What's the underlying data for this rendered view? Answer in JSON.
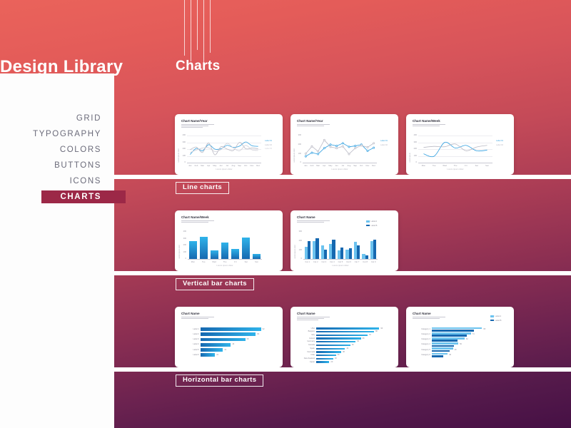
{
  "page": {
    "title": "Design Library",
    "section_heading": "Charts",
    "background_top_color": "#ea635b",
    "background_bottom_color": "#461045",
    "accent_active_color": "#9c2847",
    "chart_blue": "#2f9fe0",
    "chart_blue_dark": "#1668b0",
    "chart_gray": "#b9b9c4"
  },
  "sidebar": {
    "items": [
      {
        "label": "GRID",
        "active": false
      },
      {
        "label": "TYPOGRAPHY",
        "active": false
      },
      {
        "label": "COLORS",
        "active": false
      },
      {
        "label": "BUTTONS",
        "active": false
      },
      {
        "label": "ICONS",
        "active": false
      },
      {
        "label": "CHARTS",
        "active": true
      }
    ]
  },
  "groups": [
    {
      "tag": "Line charts"
    },
    {
      "tag": "Vertical bar charts"
    },
    {
      "tag": "Horizontal bar charts"
    }
  ],
  "chart_data": [
    {
      "id": "line-1",
      "type": "line",
      "title": "Chart Name/Year",
      "subtitle": "Lorem ipsum dolor sit amet consectetur adipiscing elit sed do eiusmod tempor",
      "xlabel": "Lorem ipsum dolor",
      "ylabel": "Lorem ipsum dolor",
      "categories": [
        "Jan",
        "Feb",
        "Mar",
        "Apr",
        "May",
        "Jun",
        "Jul",
        "Aug",
        "Sep",
        "Oct",
        "Nov",
        "Dec"
      ],
      "ylim": [
        0,
        400
      ],
      "yticks": [
        0,
        100,
        200,
        300,
        400
      ],
      "grid": true,
      "legend_position": "right",
      "series": [
        {
          "name": "Label 01",
          "color": "#2f9fe0",
          "values": [
            120,
            210,
            175,
            265,
            200,
            205,
            255,
            225,
            245,
            305,
            250,
            240
          ]
        },
        {
          "name": "Label 02",
          "color": "#b9b9c4",
          "values": [
            190,
            230,
            150,
            290,
            115,
            235,
            200,
            180,
            300,
            205,
            215,
            205
          ]
        },
        {
          "name": "Label 03",
          "color": "#cfcfd8",
          "values": [
            150,
            185,
            215,
            220,
            165,
            195,
            285,
            215,
            175,
            255,
            190,
            180
          ]
        }
      ]
    },
    {
      "id": "line-2",
      "type": "line",
      "title": "Chart Name/Year",
      "subtitle": "Lorem ipsum dolor sit amet consectetur adipiscing elit sed do eiusmod",
      "xlabel": "Lorem ipsum dolor",
      "ylabel": "Lorem ipsum dolor",
      "categories": [
        "Jan",
        "Feb",
        "Mar",
        "Apr",
        "May",
        "Jun",
        "Jul",
        "Aug",
        "Sep",
        "Oct",
        "Nov",
        "Dec"
      ],
      "ylim": [
        0,
        300
      ],
      "yticks": [
        0,
        100,
        200,
        300
      ],
      "grid": false,
      "markers": true,
      "legend_position": "right",
      "series": [
        {
          "name": "Label 01",
          "color": "#2f9fe0",
          "values": [
            70,
            110,
            95,
            160,
            200,
            185,
            215,
            175,
            185,
            200,
            130,
            165
          ]
        },
        {
          "name": "Label 02",
          "color": "#b9b9c4",
          "values": [
            100,
            180,
            125,
            250,
            175,
            160,
            180,
            95,
            160,
            190,
            170,
            215
          ]
        }
      ]
    },
    {
      "id": "line-3",
      "type": "line",
      "title": "Chart Name/Week",
      "subtitle": "Lorem ipsum dolor sit amet consectetur adipiscing elit sed do eiusmod",
      "xlabel": "Lorem ipsum dolor",
      "ylabel": "Lorem ipsum",
      "categories": [
        "Mon",
        "Tue",
        "Wed",
        "Thu",
        "Fri",
        "Sat",
        "Sun"
      ],
      "ylim": [
        0,
        400
      ],
      "yticks": [
        0,
        100,
        200,
        300,
        400
      ],
      "grid": true,
      "legend_position": "right",
      "series": [
        {
          "name": "Label 01",
          "color": "#2f9fe0",
          "values": [
            130,
            95,
            300,
            215,
            255,
            175,
            185
          ]
        },
        {
          "name": "Label 02",
          "color": "#b9b9c4",
          "values": [
            225,
            240,
            235,
            275,
            175,
            230,
            255
          ]
        }
      ]
    },
    {
      "id": "vbar-1",
      "type": "bar",
      "title": "Chart Name/Week",
      "subtitle": "Lorem ipsum dolor sit amet consectetur adipiscing elit sed do",
      "xlabel": "Lorem ipsum dolor",
      "ylabel": "Lorem ipsum dolor",
      "categories": [
        "Mon",
        "Tue",
        "Wed",
        "Thu",
        "Fri",
        "Sat",
        "Sun"
      ],
      "ylim": [
        0,
        400
      ],
      "yticks": [
        0,
        100,
        200,
        300,
        400
      ],
      "values": [
        265,
        325,
        130,
        240,
        150,
        320,
        75
      ],
      "bar_color_top": "#2fb3ea",
      "bar_color_bottom": "#1668b0"
    },
    {
      "id": "vbar-2",
      "type": "bar",
      "title": "Chart Name",
      "subtitle": "Lorem ipsum dolor sit amet consectetur adipiscing elit sed do eiusmod tempor",
      "xlabel": "Lorem ipsum dolor",
      "ylabel": "Lorem ipsum dolor",
      "categories": [
        "Cat 1",
        "Cat 2",
        "Cat 3",
        "Cat 4",
        "Cat 5",
        "Cat 6",
        "Cat 7",
        "Cat 8",
        "Cat 9"
      ],
      "ylim": [
        0,
        300
      ],
      "yticks": [
        0,
        100,
        200,
        300
      ],
      "legend_position": "top-right",
      "series": [
        {
          "name": "Label A",
          "color": "#6cc3ef",
          "values": [
            135,
            195,
            150,
            165,
            95,
            100,
            190,
            55,
            200
          ]
        },
        {
          "name": "Label B",
          "color": "#1668b0",
          "values": [
            195,
            230,
            105,
            215,
            125,
            115,
            150,
            40,
            215
          ]
        }
      ]
    },
    {
      "id": "hbar-1",
      "type": "bar",
      "orientation": "horizontal",
      "title": "Chart Name",
      "subtitle": "Lorem ipsum dolor sit amet consectetur adipiscing elit sed do",
      "categories": [
        "Label 1",
        "Label 2",
        "Label 3",
        "Label 4",
        "Label 5",
        "Label 6"
      ],
      "values": [
        92,
        84,
        68,
        46,
        34,
        22
      ],
      "value_labels": [
        "92",
        "84",
        "68",
        "46",
        "34",
        "22"
      ],
      "bar_color_left": "#1668b0",
      "bar_color_right": "#2fb3ea"
    },
    {
      "id": "hbar-2",
      "type": "bar",
      "orientation": "horizontal",
      "title": "Chart Name",
      "subtitle": "Lorem ipsum dolor sit amet consectetur adipiscing elit sed do eiusmod tempor incididunt",
      "categories": [
        "USA",
        "Belgium",
        "Italy",
        "Ireland",
        "Germany",
        "Canada",
        "Spain",
        "Denmark",
        "Chile",
        "New Zealand",
        "Japan"
      ],
      "values": [
        96,
        88,
        78,
        68,
        60,
        52,
        44,
        38,
        30,
        26,
        20
      ],
      "value_labels": [
        "96",
        "88",
        "78",
        "68",
        "60",
        "52",
        "44",
        "38",
        "30",
        "26",
        "20"
      ],
      "bar_color_left": "#1668b0",
      "bar_color_right": "#2fb3ea"
    },
    {
      "id": "hbar-3",
      "type": "bar",
      "orientation": "horizontal",
      "title": "Chart Name",
      "subtitle": "Lorem ipsum dolor sit amet consectetur adipiscing elit sed do",
      "categories": [
        "Category 1",
        "Category 2",
        "Category 3",
        "Category 4",
        "Category 5",
        "Category 6"
      ],
      "legend_position": "top-right",
      "series": [
        {
          "name": "Label A",
          "color": "#6cc3ef",
          "values": [
            95,
            74,
            62,
            50,
            40,
            30
          ]
        },
        {
          "name": "Label B",
          "color": "#1668b0",
          "values": [
            80,
            66,
            48,
            42,
            34,
            22
          ]
        }
      ],
      "value_labels": [
        "95",
        "74",
        "62",
        "50",
        "40",
        "30"
      ]
    }
  ]
}
